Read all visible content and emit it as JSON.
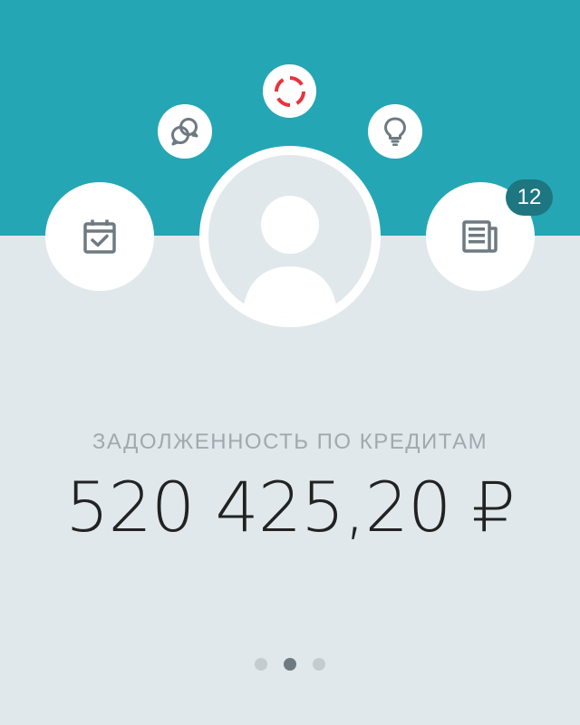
{
  "colors": {
    "header_bg": "#25a6b4",
    "page_bg": "#e1e8eb",
    "icon_gray": "#6e7a82",
    "loader_red": "#e9333d",
    "badge_bg": "#1d7680"
  },
  "actions": [
    {
      "id": "loader",
      "icon": "spinner-icon"
    },
    {
      "id": "chat",
      "icon": "chat-bubbles-icon"
    },
    {
      "id": "idea",
      "icon": "lightbulb-icon"
    },
    {
      "id": "calendar",
      "icon": "calendar-check-icon"
    },
    {
      "id": "news",
      "icon": "newspaper-icon",
      "badge": "12"
    }
  ],
  "profile": {
    "avatar_icon": "user-avatar-icon"
  },
  "debt": {
    "label": "ЗАДОЛЖЕННОСТЬ ПО КРЕДИТАМ",
    "amount": "520 425,20 ₽"
  },
  "pagination": {
    "total": 3,
    "active_index": 1
  }
}
